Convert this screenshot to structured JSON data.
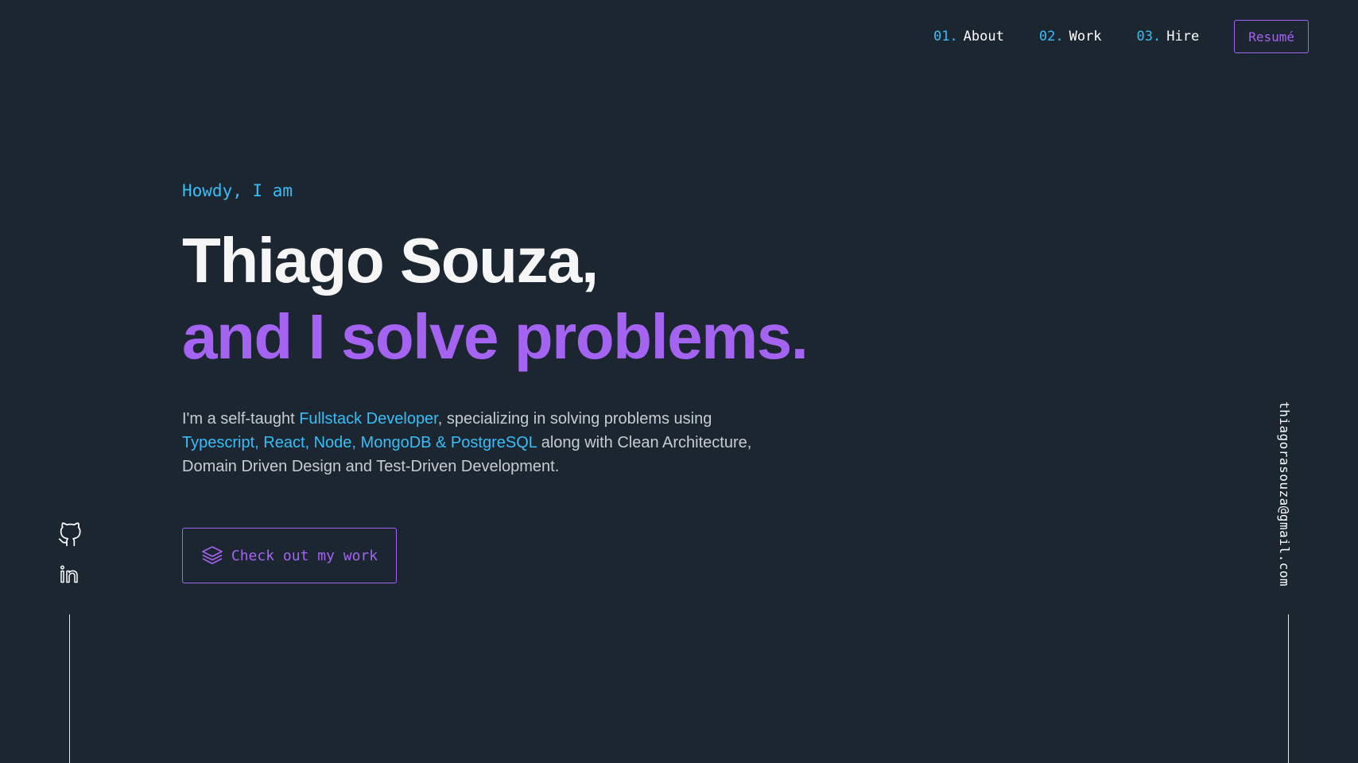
{
  "nav": {
    "links": [
      {
        "num": "01.",
        "label": "About"
      },
      {
        "num": "02.",
        "label": "Work"
      },
      {
        "num": "03.",
        "label": "Hire"
      }
    ],
    "resume_label": "Resumé"
  },
  "hero": {
    "greeting": "Howdy, I am",
    "name": "Thiago Souza,",
    "tagline": "and I solve problems.",
    "bio": {
      "p1": "I'm a self-taught ",
      "h1": "Fullstack Developer",
      "p2": ", specializing in solving problems using ",
      "h2": "Typescript, React, Node, MongoDB & PostgreSQL",
      "p3": " along with Clean Architecture, Domain Driven Design and Test-Driven Development."
    },
    "cta_label": "Check out my work",
    "cta_icon": "layers-icon"
  },
  "social": {
    "icons": [
      "github-icon",
      "linkedin-icon"
    ]
  },
  "email": "thiagorasouza@gmail.com",
  "colors": {
    "background": "#1b2631",
    "accent_purple": "#a563f2",
    "accent_cyan": "#38bdf8",
    "text_white": "#ffffff",
    "text_muted": "#c7ccd3"
  }
}
